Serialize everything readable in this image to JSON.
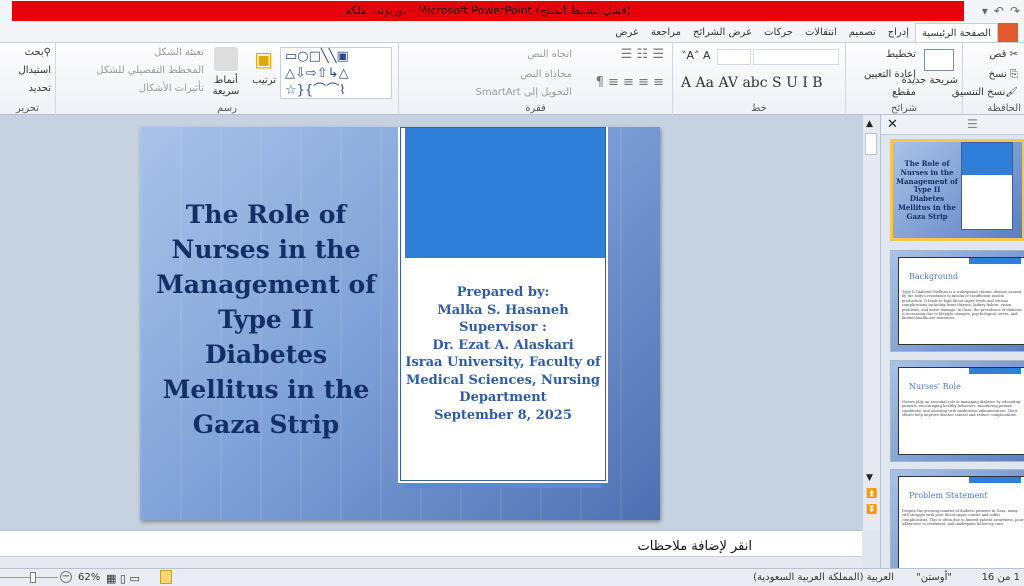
{
  "window": {
    "title": "بوربونت ملكه - Microsoft PowerPoint (فشل تنشيط المنتج)"
  },
  "tabs": [
    {
      "label": "الصفحة الرئيسية",
      "active": true
    },
    {
      "label": "إدراج"
    },
    {
      "label": "تصميم"
    },
    {
      "label": "انتقالات"
    },
    {
      "label": "حركات"
    },
    {
      "label": "عرض الشرائح"
    },
    {
      "label": "مراجعة"
    },
    {
      "label": "عرض"
    }
  ],
  "ribbon": {
    "clipboard": {
      "label": "الحافظة",
      "cut": "قص",
      "copy": "نسخ",
      "format_painter": "نسخ التنسيق"
    },
    "slides": {
      "label": "شرائح",
      "new_slide": "شريحة جديدة",
      "layout": "تخطيط",
      "reset": "إعادة التعيين",
      "section": "مقطع"
    },
    "font": {
      "label": "خط"
    },
    "paragraph": {
      "label": "فقرة",
      "text_direction": "اتجاه النص",
      "align_text": "محاذاة النص",
      "smartart": "التحويل إلى SmartArt"
    },
    "drawing": {
      "label": "رسم",
      "arrange": "ترتيب",
      "quick_styles": "أنماط سريعة",
      "shape_fill": "تعبئة الشكل",
      "shape_outline": "المخطط التفصيلي للشكل",
      "shape_effects": "تأثيرات الأشكال"
    },
    "editing": {
      "label": "تحرير",
      "find": "بحث",
      "replace": "استبدال",
      "select": "تحديد"
    }
  },
  "slide": {
    "title": "The Role of Nurses in the Management of Type II Diabetes Mellitus in the Gaza Strip",
    "card_lines": [
      "Prepared by:",
      "Malka S. Hasaneh",
      "Supervisor :",
      "Dr. Ezat A. Alaskari",
      "Israa University, Faculty of Medical Sciences, Nursing Department",
      "September 8, 2025"
    ],
    "accent": "#2f7fd8",
    "title_color": "#142e66"
  },
  "thumbnails": [
    {
      "title": "The Role of Nurses in the Management of Type II Diabetes Mellitus in the Gaza Strip",
      "selected": true
    },
    {
      "title": "Background",
      "body": "Type II Diabetes Mellitus is a widespread chronic disease caused by the body's resistance to insulin or insufficient insulin production. It leads to high blood sugar levels and serious complications including heart disease, kidney failure, vision problems, and nerve damage. In Gaza, the prevalence of diabetes is increasing due to lifestyle changes, psychological stress, and limited healthcare resources."
    },
    {
      "title": "Nurses' Role",
      "body": "Nurses play an essential role in managing diabetes by educating patients, encouraging healthy behaviors, monitoring patient conditions, and assisting with medication administration. Their efforts help improve disease control and reduce complications."
    },
    {
      "title": "Problem Statement",
      "body": "Despite the growing number of diabetic patients in Gaza, many still struggle with poor blood sugar control and suffer complications. This is often due to limited patient awareness, poor adherence to treatment, and inadequate follow-up care."
    }
  ],
  "notes": {
    "placeholder": "انقر لإضافة ملاحظات"
  },
  "status": {
    "slide_count": "1 من 16",
    "theme": "\"أوستن\"",
    "language": "العربية (المملكة العربية السعودية)",
    "zoom": "62%"
  }
}
